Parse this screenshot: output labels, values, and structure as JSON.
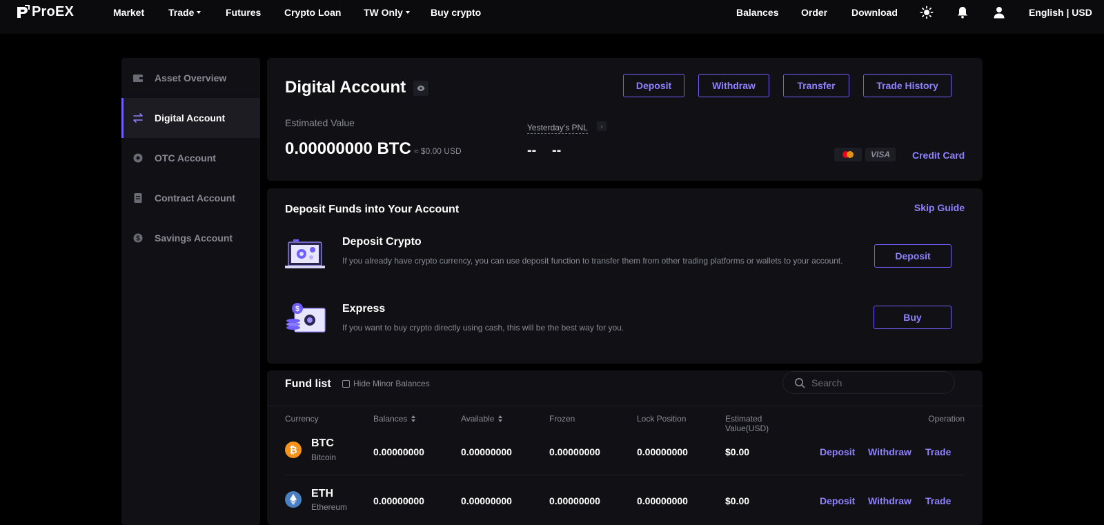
{
  "brand": {
    "name": "ProEX"
  },
  "nav": {
    "market": "Market",
    "trade": "Trade",
    "futures": "Futures",
    "crypto_loan": "Crypto Loan",
    "tw_only": "TW Only",
    "buy_crypto": "Buy crypto",
    "balances": "Balances",
    "order": "Order",
    "download": "Download",
    "lang_currency": "English | USD"
  },
  "sidebar": {
    "items": [
      {
        "label": "Asset Overview",
        "icon": "wallet-icon",
        "active": false
      },
      {
        "label": "Digital Account",
        "icon": "transfer-arrows-icon",
        "active": true
      },
      {
        "label": "OTC Account",
        "icon": "circle-icon",
        "active": false
      },
      {
        "label": "Contract Account",
        "icon": "document-icon",
        "active": false
      },
      {
        "label": "Savings Account",
        "icon": "dollar-coin-icon",
        "active": false
      }
    ]
  },
  "account": {
    "title": "Digital Account",
    "buttons": {
      "deposit": "Deposit",
      "withdraw": "Withdraw",
      "transfer": "Transfer",
      "trade_history": "Trade History"
    },
    "estimated_label": "Estimated Value",
    "estimated_value": "0.00000000 BTC",
    "estimated_usd": "≈ $0.00 USD",
    "pnl_label": "Yesterday's PNL",
    "pnl_value": "--",
    "pnl_percent": "--",
    "visa_label": "VISA",
    "credit_card": "Credit Card"
  },
  "guide": {
    "title": "Deposit Funds into Your Account",
    "skip": "Skip Guide",
    "deposit_crypto": {
      "title": "Deposit Crypto",
      "desc": "If you already have crypto currency, you can use deposit function to transfer them from other trading platforms or wallets to your account.",
      "button": "Deposit"
    },
    "express": {
      "title": "Express",
      "desc": "If you want to buy crypto directly using cash, this will be the best way for you.",
      "button": "Buy"
    }
  },
  "fund_list": {
    "title": "Fund list",
    "hide_minor": "Hide Minor Balances",
    "search_placeholder": "Search",
    "columns": {
      "currency": "Currency",
      "balances": "Balances",
      "available": "Available",
      "frozen": "Frozen",
      "lock_position": "Lock Position",
      "estimated_value_1": "Estimated",
      "estimated_value_2": "Value(USD)",
      "operation": "Operation"
    },
    "rows": [
      {
        "symbol": "BTC",
        "name": "Bitcoin",
        "balances": "0.00000000",
        "available": "0.00000000",
        "frozen": "0.00000000",
        "lock": "0.00000000",
        "usd": "$0.00",
        "ops": [
          "Deposit",
          "Withdraw",
          "Trade"
        ]
      },
      {
        "symbol": "ETH",
        "name": "Ethereum",
        "balances": "0.00000000",
        "available": "0.00000000",
        "frozen": "0.00000000",
        "lock": "0.00000000",
        "usd": "$0.00",
        "ops": [
          "Deposit",
          "Withdraw",
          "Trade"
        ]
      }
    ]
  },
  "colors": {
    "accent": "#6f5fff",
    "link": "#8f82ff",
    "panel": "#111115",
    "background": "#000000",
    "btc": "#f7931a",
    "eth": "#4a7fc1"
  }
}
